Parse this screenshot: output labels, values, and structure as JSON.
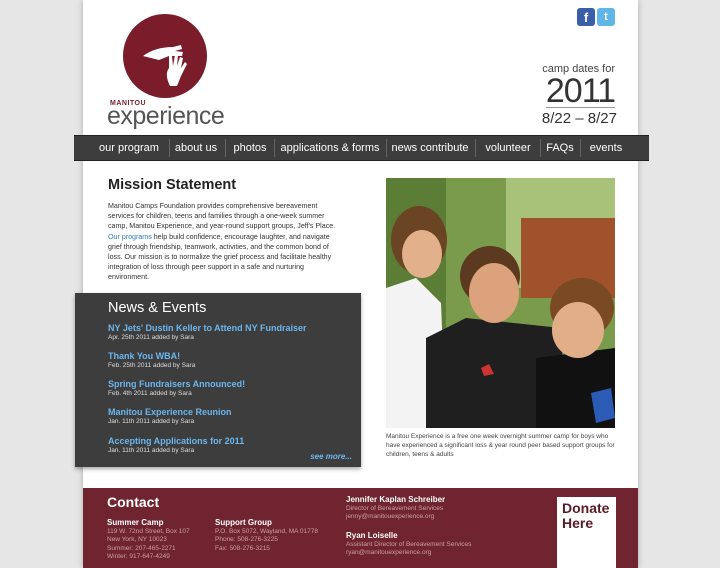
{
  "social": {
    "facebook": "f",
    "twitter": "t"
  },
  "logo": {
    "brand": "MANITOU",
    "wordmark": "experience"
  },
  "camp_dates": {
    "label": "camp dates for",
    "year": "2011",
    "range": "8/22 – 8/27"
  },
  "nav": {
    "items": [
      {
        "label": "our program"
      },
      {
        "label": "about us"
      },
      {
        "label": "photos"
      },
      {
        "label": "applications & forms"
      },
      {
        "label": "news contribute"
      },
      {
        "label": "volunteer"
      },
      {
        "label": "FAQs"
      },
      {
        "label": "events"
      }
    ]
  },
  "mission": {
    "title": "Mission Statement",
    "text_before": "Manitou Camps Foundation provides comprehensive bereavement services for children, teens and families through a one-week summer camp, Manitou Experience, and year-round support groups, Jeff's Place. ",
    "link": "Our programs",
    "text_after": " help build confidence, encourage laughter, and navigate grief through friendship, teamwork, activities, and the common bond of loss. Our mission is to normalize the grief process and facilitate healthy integration of loss through peer support in a safe and nurturing environment."
  },
  "photo": {
    "caption": "Manitou Experience is a free one week overnight summer camp for boys who have experienced a significant loss & year round peer based support groups for children, teens & adults"
  },
  "news": {
    "title": "News & Events",
    "items": [
      {
        "title": "NY Jets' Dustin Keller to Attend NY Fundraiser",
        "meta": "Apr. 25th 2011 added by Sara"
      },
      {
        "title": "Thank You WBA!",
        "meta": "Feb. 25th 2011 added by Sara"
      },
      {
        "title": "Spring Fundraisers Announced!",
        "meta": "Feb. 4th 2011 added by Sara"
      },
      {
        "title": "Manitou Experience Reunion",
        "meta": "Jan. 11th 2011 added by Sara"
      },
      {
        "title": "Accepting Applications for 2011",
        "meta": "Jan. 11th 2011 added by Sara"
      }
    ],
    "see_more": "see more..."
  },
  "footer": {
    "contact_title": "Contact",
    "summer_camp": {
      "heading": "Summer Camp",
      "lines": [
        "119 W. 72nd Street, Box 107",
        "New York, NY 10023",
        "Summer: 207-465-2271",
        "Winter: 917-647-4249"
      ]
    },
    "support_group": {
      "heading": "Support Group",
      "lines": [
        "P.O. Box 5072, Wayland, MA 01778",
        "Phone: 508-276-3225",
        "Fax: 508-276-3215"
      ]
    },
    "person1": {
      "name": "Jennifer Kaplan Schreiber",
      "title": "Director of Bereavement Services",
      "email": "jenny@manitouexperience.org"
    },
    "person2": {
      "name": "Ryan Loiselle",
      "title": "Assistant Director of Bereavement Services",
      "email": "ryan@manitouexperience.org"
    },
    "donate": "Donate Here"
  },
  "colors": {
    "brand": "#7b1c2b",
    "footer": "#702430",
    "nav": "#3d3d3d",
    "link": "#6bb6ef"
  }
}
